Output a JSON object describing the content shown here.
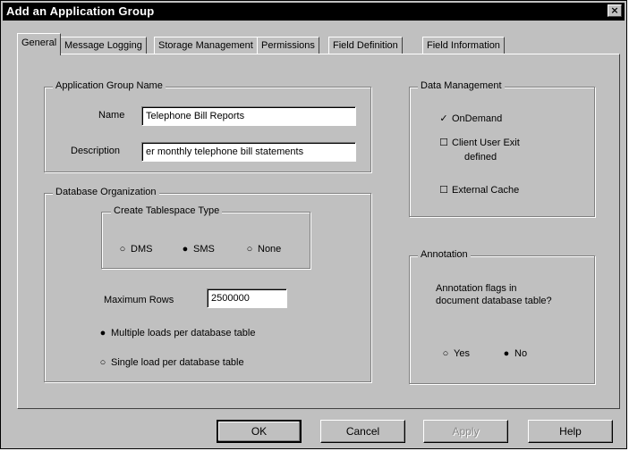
{
  "window": {
    "title": "Add an Application Group",
    "close_glyph": "×"
  },
  "tabs": [
    {
      "label": "General",
      "active": true
    },
    {
      "label": "Message Logging",
      "active": false
    },
    {
      "label": "Storage Management",
      "active": false
    },
    {
      "label": "Permissions",
      "active": false
    },
    {
      "label": "Field Definition",
      "active": false
    },
    {
      "label": "Field Information",
      "active": false
    }
  ],
  "app_group_name": {
    "group_label": "Application Group Name",
    "name_label": "Name",
    "name_value": "Telephone Bill Reports",
    "description_label": "Description",
    "description_value": "er monthly telephone bill statements"
  },
  "database_organization": {
    "group_label": "Database Organization",
    "tablespace": {
      "group_label": "Create Tablespace Type",
      "options": [
        {
          "label": "DMS",
          "selected": false
        },
        {
          "label": "SMS",
          "selected": true
        },
        {
          "label": "None",
          "selected": false
        }
      ]
    },
    "max_rows_label": "Maximum Rows",
    "max_rows_value": "2500000",
    "load_options": [
      {
        "label": "Multiple loads per database table",
        "selected": true
      },
      {
        "label": "Single load per database table",
        "selected": false
      }
    ]
  },
  "data_management": {
    "group_label": "Data Management",
    "on_demand_label": "OnDemand",
    "on_demand_checked": true,
    "client_exit_label_line1": "Client User Exit",
    "client_exit_label_line2": "defined",
    "client_exit_checked": false,
    "external_cache_label": "External Cache",
    "external_cache_checked": false
  },
  "annotation": {
    "group_label": "Annotation",
    "question": "Annotation flags in document database table?",
    "options": [
      {
        "label": "Yes",
        "selected": false
      },
      {
        "label": "No",
        "selected": true
      }
    ]
  },
  "buttons": {
    "ok": "OK",
    "cancel": "Cancel",
    "apply": "Apply",
    "help": "Help"
  },
  "glyphs": {
    "radio_on": "●",
    "radio_off": "○",
    "check_on": "✓",
    "check_off": "☐"
  }
}
